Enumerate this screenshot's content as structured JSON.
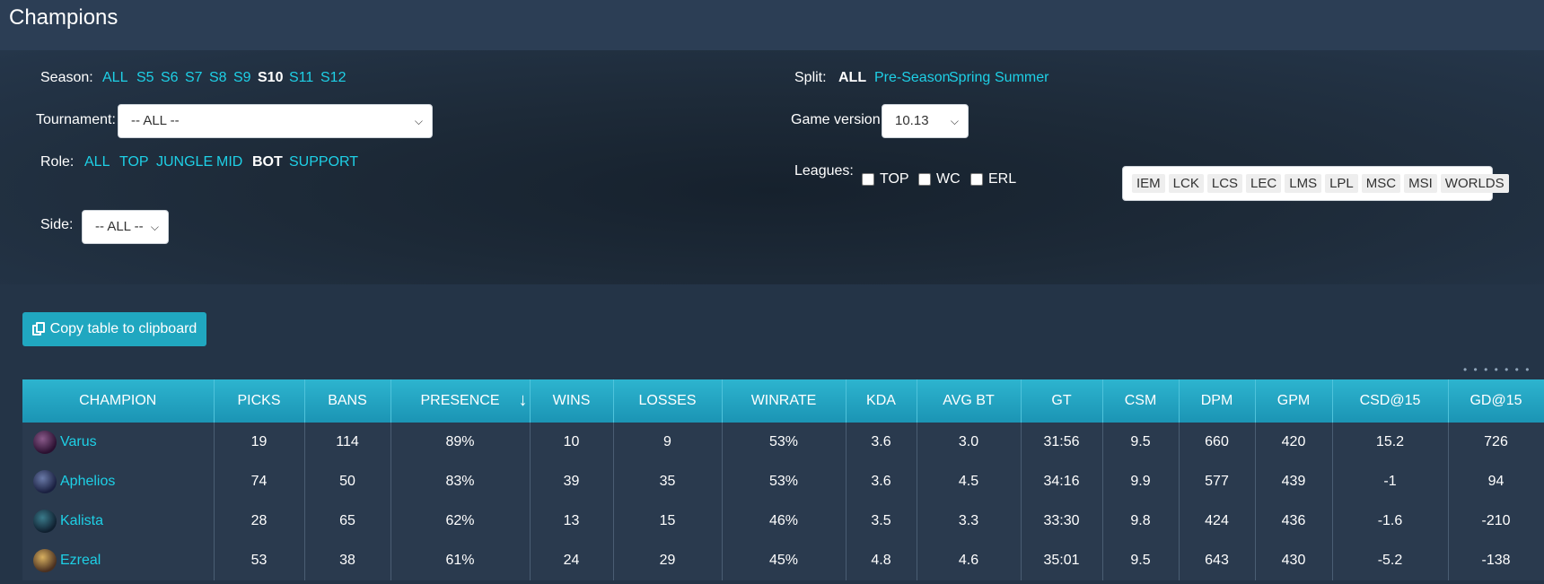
{
  "header": {
    "title": "Champions"
  },
  "filters": {
    "season": {
      "label": "Season:",
      "options": [
        "ALL",
        "S5",
        "S6",
        "S7",
        "S8",
        "S9",
        "S10",
        "S11",
        "S12"
      ],
      "active": "S10"
    },
    "split": {
      "label": "Split:",
      "options": [
        "ALL",
        "Pre-Season",
        "Spring",
        "Summer"
      ],
      "active": "ALL"
    },
    "tournament": {
      "label": "Tournament:",
      "value": "-- ALL --"
    },
    "game_version": {
      "label": "Game version:",
      "value": "10.13"
    },
    "role": {
      "label": "Role:",
      "options": [
        "ALL",
        "TOP",
        "JUNGLE",
        "MID",
        "BOT",
        "SUPPORT"
      ],
      "active": "BOT"
    },
    "leagues": {
      "label": "Leagues:",
      "checkboxes": [
        "TOP",
        "WC",
        "ERL"
      ],
      "tags": [
        "IEM",
        "LCK",
        "LCS",
        "LEC",
        "LMS",
        "LPL",
        "MSC",
        "MSI",
        "WORLDS"
      ]
    },
    "side": {
      "label": "Side:",
      "value": "-- ALL --"
    }
  },
  "copy_button": {
    "label": "Copy table to clipboard"
  },
  "table": {
    "columns": [
      "CHAMPION",
      "PICKS",
      "BANS",
      "PRESENCE",
      "WINS",
      "LOSSES",
      "WINRATE",
      "KDA",
      "AVG BT",
      "GT",
      "CSM",
      "DPM",
      "GPM",
      "CSD@15",
      "GD@15"
    ],
    "sort_indicator": "↓",
    "rows": [
      [
        "Varus",
        "19",
        "114",
        "89%",
        "10",
        "9",
        "53%",
        "3.6",
        "3.0",
        "31:56",
        "9.5",
        "660",
        "420",
        "15.2",
        "726"
      ],
      [
        "Aphelios",
        "74",
        "50",
        "83%",
        "39",
        "35",
        "53%",
        "3.6",
        "4.5",
        "34:16",
        "9.9",
        "577",
        "439",
        "-1",
        "94"
      ],
      [
        "Kalista",
        "28",
        "65",
        "62%",
        "13",
        "15",
        "46%",
        "3.5",
        "3.3",
        "33:30",
        "9.8",
        "424",
        "436",
        "-1.6",
        "-210"
      ],
      [
        "Ezreal",
        "53",
        "38",
        "61%",
        "24",
        "29",
        "45%",
        "4.8",
        "4.6",
        "35:01",
        "9.5",
        "643",
        "430",
        "-5.2",
        "-138"
      ]
    ]
  },
  "colors": {
    "accent": "#1ed0e6",
    "header_bg": "#2c3e55",
    "table_head": "#22a6c2"
  }
}
